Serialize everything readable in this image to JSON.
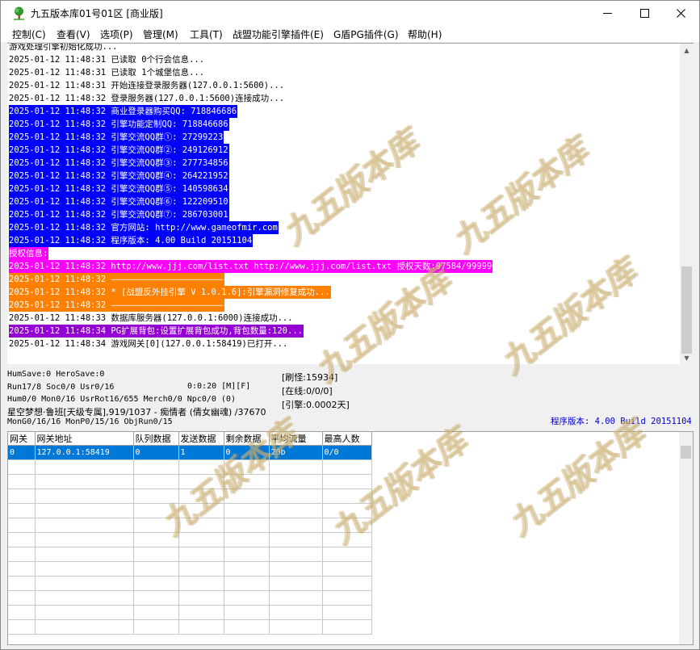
{
  "window": {
    "title": "九五版本库01号01区 [商业版]",
    "minimize_glyph": "—",
    "maximize_glyph": "☐",
    "close_glyph": "✕"
  },
  "menu": [
    "控制(C)",
    "查看(V)",
    "选项(P)",
    "管理(M)",
    "工具(T)",
    "战盟功能引擎插件(E)",
    "G盾PG插件(G)",
    "帮助(H)"
  ],
  "log": [
    {
      "text": "游戏处理引擎初始化成功...",
      "fg": "#000000",
      "bg": "#ffffff",
      "full": false
    },
    {
      "text": "2025-01-12 11:48:31 已读取 0个行会信息...",
      "fg": "#000000",
      "bg": "#ffffff",
      "full": false
    },
    {
      "text": "2025-01-12 11:48:31 已读取 1个城堡信息...",
      "fg": "#000000",
      "bg": "#ffffff",
      "full": false
    },
    {
      "text": "2025-01-12 11:48:31 开始连接登录服务器(127.0.0.1:5600)...",
      "fg": "#000000",
      "bg": "#ffffff",
      "full": false
    },
    {
      "text": "2025-01-12 11:48:32 登录服务器(127.0.0.1:5600)连接成功...",
      "fg": "#000000",
      "bg": "#ffffff",
      "full": false
    },
    {
      "text": "2025-01-12 11:48:32 商业登录器购买QQ: 718846686",
      "fg": "#ffffff",
      "bg": "#0000ff",
      "full": false
    },
    {
      "text": "2025-01-12 11:48:32 引擎功能定制QQ: 718846686",
      "fg": "#ffffff",
      "bg": "#0000ff",
      "full": false
    },
    {
      "text": "2025-01-12 11:48:32 引擎交流QQ群①: 27299223",
      "fg": "#ffffff",
      "bg": "#0000ff",
      "full": false
    },
    {
      "text": "2025-01-12 11:48:32 引擎交流QQ群②: 249126912",
      "fg": "#ffffff",
      "bg": "#0000ff",
      "full": false
    },
    {
      "text": "2025-01-12 11:48:32 引擎交流QQ群③: 277734856",
      "fg": "#ffffff",
      "bg": "#0000ff",
      "full": false
    },
    {
      "text": "2025-01-12 11:48:32 引擎交流QQ群④: 264221952",
      "fg": "#ffffff",
      "bg": "#0000ff",
      "full": false
    },
    {
      "text": "2025-01-12 11:48:32 引擎交流QQ群⑤: 140598634",
      "fg": "#ffffff",
      "bg": "#0000ff",
      "full": false
    },
    {
      "text": "2025-01-12 11:48:32 引擎交流QQ群⑥: 122209510",
      "fg": "#ffffff",
      "bg": "#0000ff",
      "full": false
    },
    {
      "text": "2025-01-12 11:48:32 引擎交流QQ群⑦: 286703001",
      "fg": "#ffffff",
      "bg": "#0000ff",
      "full": false
    },
    {
      "text": "2025-01-12 11:48:32 官方网站: http://www.gameofmir.com",
      "fg": "#ffffff",
      "bg": "#0000ff",
      "full": false
    },
    {
      "text": "2025-01-12 11:48:32 程序版本: 4.00 Build 20151104",
      "fg": "#ffffff",
      "bg": "#0000ff",
      "full": false
    },
    {
      "text": "授权信息:",
      "fg": "#ffffff",
      "bg": "#ff00ff",
      "full": false
    },
    {
      "text": "2025-01-12 11:48:32 http://www.jjj.com/list.txt http://www.jjj.com/list.txt 授权天数:97584/99999",
      "fg": "#ffffff",
      "bg": "#ff00ff",
      "full": false
    },
    {
      "text": "2025-01-12 11:48:32 ——————————————————————",
      "fg": "#ffffff",
      "bg": "#ff7f00",
      "full": false
    },
    {
      "text": "2025-01-12 11:48:32 * [战盟反外挂引擎 V 1.0.1.6]:引擎漏洞修复成功...",
      "fg": "#ffffff",
      "bg": "#ff7f00",
      "full": false
    },
    {
      "text": "2025-01-12 11:48:32 ——————————————————————",
      "fg": "#ffffff",
      "bg": "#ff7f00",
      "full": false
    },
    {
      "text": "2025-01-12 11:48:33 数据库服务器(127.0.0.1:6000)连接成功...",
      "fg": "#000000",
      "bg": "#ffffff",
      "full": false
    },
    {
      "text": "2025-01-12 11:48:34 PG扩展背包:设置扩展背包成功,背包数量:120...",
      "fg": "#ffffff",
      "bg": "#9400d3",
      "full": false
    },
    {
      "text": "2025-01-12 11:48:34 游戏网关[0](127.0.0.1:58419)已打开...",
      "fg": "#000000",
      "bg": "#ffffff",
      "full": false
    }
  ],
  "status": {
    "humsave": "HumSave:0 HeroSave:0",
    "run": "Run17/8 Soc0/0 Usr0/16",
    "timer": "0:0:20 [M][F]",
    "monster_refresh": "[刷怪:15934]",
    "online": "[在线:0/0/0]",
    "engine": "[引擎:0.0002天]",
    "hum": "Hum0/0 Mon0/16 UsrRot16/655 Merch0/0 Npc0/0 (0)",
    "char": "星空梦想·鲁班[天级专属],919/1037 - 痴情者 (倩女幽魂) /37670",
    "mon": "MonG0/16/16 MonP0/15/16 ObjRun0/15",
    "version": "程序版本: 4.00 Build 20151104",
    "version_color": "#0000cc"
  },
  "grid": {
    "columns": [
      "网关",
      "网关地址",
      "队列数据",
      "发送数据",
      "剩余数据",
      "平均流量",
      "最高人数"
    ],
    "rows": [
      [
        "0",
        "127.0.0.1:58419",
        "0",
        "1",
        "0",
        "20b",
        "0/0"
      ]
    ],
    "selected_color": "#0078d7"
  },
  "watermark": {
    "text": "九五版本库",
    "color": "#d6ba78"
  }
}
